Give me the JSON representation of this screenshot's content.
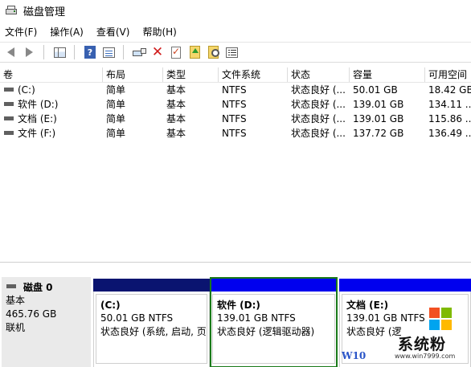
{
  "window": {
    "title": "磁盘管理"
  },
  "menu": [
    {
      "label": "文件(F)"
    },
    {
      "label": "操作(A)"
    },
    {
      "label": "查看(V)"
    },
    {
      "label": "帮助(H)"
    }
  ],
  "toolbar": {
    "icons": [
      "back-icon",
      "forward-icon",
      "show-hide-panel-icon",
      "help-icon",
      "properties-icon",
      "connect-disk-icon",
      "delete-icon",
      "check-icon",
      "folder-up-icon",
      "search-icon",
      "list-view-icon"
    ]
  },
  "volume_table": {
    "columns": [
      "卷",
      "布局",
      "类型",
      "文件系统",
      "状态",
      "容量",
      "可用空间"
    ],
    "rows": [
      {
        "volume": "(C:)",
        "layout": "简单",
        "type": "基本",
        "fs": "NTFS",
        "status": "状态良好 (...",
        "capacity": "50.01 GB",
        "free": "18.42 GB"
      },
      {
        "volume": "软件 (D:)",
        "layout": "简单",
        "type": "基本",
        "fs": "NTFS",
        "status": "状态良好 (...",
        "capacity": "139.01 GB",
        "free": "134.11 ..."
      },
      {
        "volume": "文档 (E:)",
        "layout": "简单",
        "type": "基本",
        "fs": "NTFS",
        "status": "状态良好 (...",
        "capacity": "139.01 GB",
        "free": "115.86 ..."
      },
      {
        "volume": "文件 (F:)",
        "layout": "简单",
        "type": "基本",
        "fs": "NTFS",
        "status": "状态良好 (...",
        "capacity": "137.72 GB",
        "free": "136.49 ..."
      }
    ]
  },
  "disk": {
    "name": "磁盘 0",
    "type": "基本",
    "size": "465.76 GB",
    "state": "联机",
    "partitions": [
      {
        "name": "(C:)",
        "size": "50.01 GB NTFS",
        "status": "状态良好 (系统, 启动, 页",
        "bar_color": "#0a1470"
      },
      {
        "name": "软件 (D:)",
        "size": "139.01 GB NTFS",
        "status": "状态良好 (逻辑驱动器)",
        "bar_color": "#0000ee"
      },
      {
        "name": "文档 (E:)",
        "size": "139.01 GB NTFS",
        "status": "状态良好 (逻",
        "bar_color": "#0000ee"
      }
    ]
  },
  "watermark": {
    "brand": "系统粉",
    "w10_text": "W10",
    "url": "www.win7999.com"
  },
  "colors": {
    "selection_border": "#1a7a1a"
  }
}
